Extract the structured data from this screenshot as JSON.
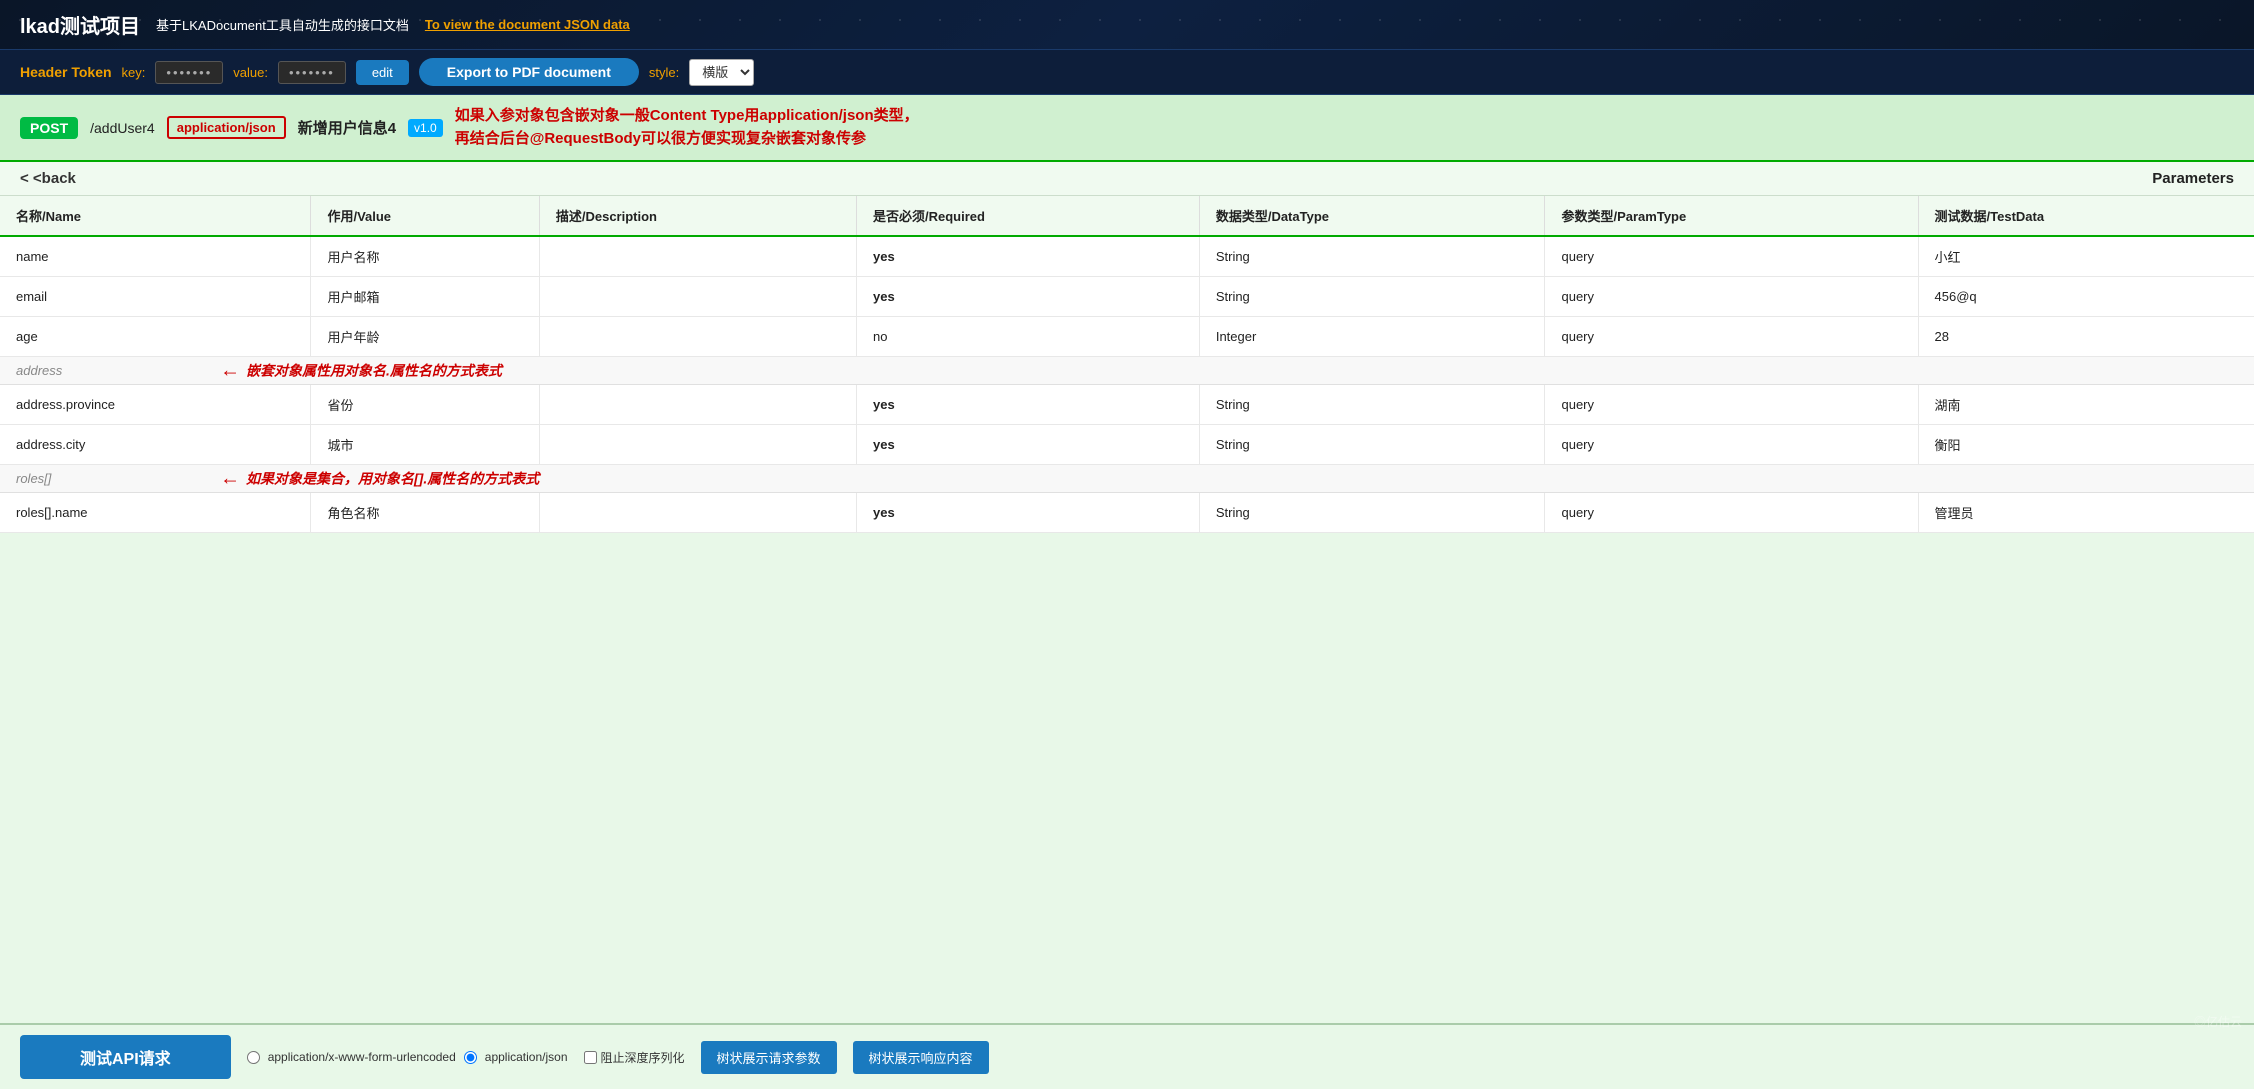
{
  "header": {
    "title": "lkad测试项目",
    "subtitle": "基于LKADocument工具自动生成的接口文档",
    "json_link": "To view the document JSON data"
  },
  "toolbar": {
    "token_label": "Header Token",
    "key_label": "key:",
    "key_value": "•••••••",
    "value_label": "value:",
    "value_value": "•••••••",
    "edit_label": "edit",
    "export_label": "Export to PDF document",
    "style_label": "style:",
    "style_option": "横版"
  },
  "api": {
    "method": "POST",
    "path": "/addUser4",
    "content_type": "application/json",
    "name": "新增用户信息4",
    "version": "v1.0",
    "description_line1": "如果入参对象包含嵌对象一般Content Type用application/json类型，",
    "description_line2": "再结合后台@RequestBody可以很方便实现复杂嵌套对象传参"
  },
  "nav": {
    "back_label": "< <back",
    "params_label": "Parameters"
  },
  "table": {
    "columns": [
      "名称/Name",
      "作用/Value",
      "描述/Description",
      "是否必须/Required",
      "数据类型/DataType",
      "参数类型/ParamType",
      "测试数据/TestData"
    ],
    "rows": [
      {
        "name": "name",
        "value": "用户名称",
        "description": "",
        "required": "yes",
        "datatype": "String",
        "paramtype": "query",
        "testdata": "小红",
        "type": "field"
      },
      {
        "name": "email",
        "value": "用户邮箱",
        "description": "",
        "required": "yes",
        "datatype": "String",
        "paramtype": "query",
        "testdata": "456@q",
        "type": "field"
      },
      {
        "name": "age",
        "value": "用户年龄",
        "description": "",
        "required": "no",
        "datatype": "Integer",
        "paramtype": "query",
        "testdata": "28",
        "type": "field"
      },
      {
        "name": "address",
        "value": "",
        "description": "",
        "required": "",
        "datatype": "",
        "paramtype": "",
        "testdata": "",
        "type": "group",
        "annotation": "嵌套对象属性用对象名.属性名的方式表式"
      },
      {
        "name": "address.province",
        "value": "省份",
        "description": "",
        "required": "yes",
        "datatype": "String",
        "paramtype": "query",
        "testdata": "湖南",
        "type": "field"
      },
      {
        "name": "address.city",
        "value": "城市",
        "description": "",
        "required": "yes",
        "datatype": "String",
        "paramtype": "query",
        "testdata": "衡阳",
        "type": "field"
      },
      {
        "name": "roles[]",
        "value": "",
        "description": "",
        "required": "",
        "datatype": "",
        "paramtype": "",
        "testdata": "",
        "type": "group",
        "annotation": "如果对象是集合，用对象名[].属性名的方式表式"
      },
      {
        "name": "roles[].name",
        "value": "角色名称",
        "description": "",
        "required": "yes",
        "datatype": "String",
        "paramtype": "query",
        "testdata": "管理员",
        "type": "field"
      }
    ]
  },
  "footer": {
    "test_api_label": "测试API请求",
    "radio_option1": "application/x-www-form-urlencoded",
    "radio_option2": "application/json",
    "checkbox_label": "阻止深度序列化",
    "btn_tree_request": "树状展示请求参数",
    "btn_tree_response": "树状展示响应内容"
  },
  "watermark": "◎亿估云"
}
